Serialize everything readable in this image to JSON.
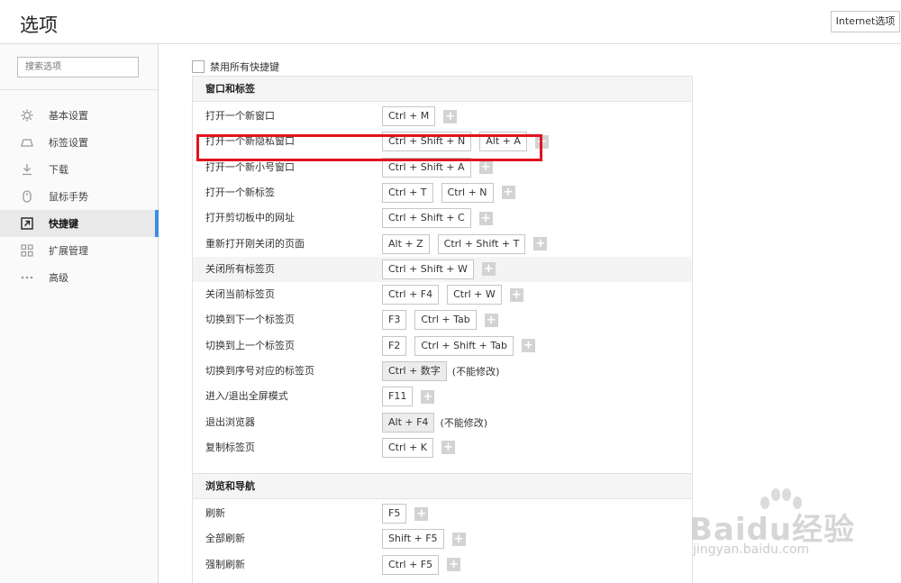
{
  "header": {
    "title": "选项",
    "internet_button": "Internet选项"
  },
  "sidebar": {
    "search_placeholder": "搜索选项",
    "items": [
      {
        "label": "基本设置",
        "icon": "gear-icon",
        "active": false
      },
      {
        "label": "标签设置",
        "icon": "tab-icon",
        "active": false
      },
      {
        "label": "下载",
        "icon": "download-icon",
        "active": false
      },
      {
        "label": "鼠标手势",
        "icon": "mouse-icon",
        "active": false
      },
      {
        "label": "快捷键",
        "icon": "shortcut-arrow-icon",
        "active": true
      },
      {
        "label": "扩展管理",
        "icon": "extensions-grid-icon",
        "active": false
      },
      {
        "label": "高级",
        "icon": "more-dots-icon",
        "active": false
      }
    ]
  },
  "content": {
    "disable_all_label": "禁用所有快捷键",
    "sections": [
      {
        "title": "窗口和标签",
        "rows": [
          {
            "name": "打开一个新窗口",
            "keys": [
              "Ctrl + M"
            ],
            "plus": true
          },
          {
            "name": "打开一个新隐私窗口",
            "keys": [
              "Ctrl + Shift + N",
              "Alt + A"
            ],
            "plus": true
          },
          {
            "name": "打开一个新小号窗口",
            "keys": [
              "Ctrl + Shift + A"
            ],
            "plus": true
          },
          {
            "name": "打开一个新标签",
            "keys": [
              "Ctrl + T",
              "Ctrl + N"
            ],
            "plus": true
          },
          {
            "name": "打开剪切板中的网址",
            "keys": [
              "Ctrl + Shift + C"
            ],
            "plus": true
          },
          {
            "name": "重新打开刚关闭的页面",
            "keys": [
              "Alt + Z",
              "Ctrl + Shift + T"
            ],
            "plus": true
          },
          {
            "name": "关闭所有标签页",
            "keys": [
              "Ctrl + Shift + W"
            ],
            "plus": true
          },
          {
            "name": "关闭当前标签页",
            "keys": [
              "Ctrl + F4",
              "Ctrl + W"
            ],
            "plus": true
          },
          {
            "name": "切换到下一个标签页",
            "keys": [
              "F3",
              "Ctrl + Tab"
            ],
            "plus": true
          },
          {
            "name": "切换到上一个标签页",
            "keys": [
              "F2",
              "Ctrl + Shift + Tab"
            ],
            "plus": true
          },
          {
            "name": "切换到序号对应的标签页",
            "keys": [
              "Ctrl + 数字"
            ],
            "plus": false,
            "note": "(不能修改)"
          },
          {
            "name": "进入/退出全屏模式",
            "keys": [
              "F11"
            ],
            "plus": true
          },
          {
            "name": "退出浏览器",
            "keys": [
              "Alt + F4"
            ],
            "plus": false,
            "note": "(不能修改)"
          },
          {
            "name": "复制标签页",
            "keys": [
              "Ctrl + K"
            ],
            "plus": true
          }
        ]
      },
      {
        "title": "浏览和导航",
        "rows": [
          {
            "name": "刷新",
            "keys": [
              "F5"
            ],
            "plus": true
          },
          {
            "name": "全部刷新",
            "keys": [
              "Shift + F5"
            ],
            "plus": true
          },
          {
            "name": "强制刷新",
            "keys": [
              "Ctrl + F5"
            ],
            "plus": true
          }
        ]
      }
    ],
    "plus_symbol": "+"
  },
  "watermark": {
    "text": "Baidu经验",
    "sub": "jingyan.baidu.com"
  },
  "colors": {
    "highlight_box": "#e0141e",
    "active_indicator": "#3b8de0"
  }
}
